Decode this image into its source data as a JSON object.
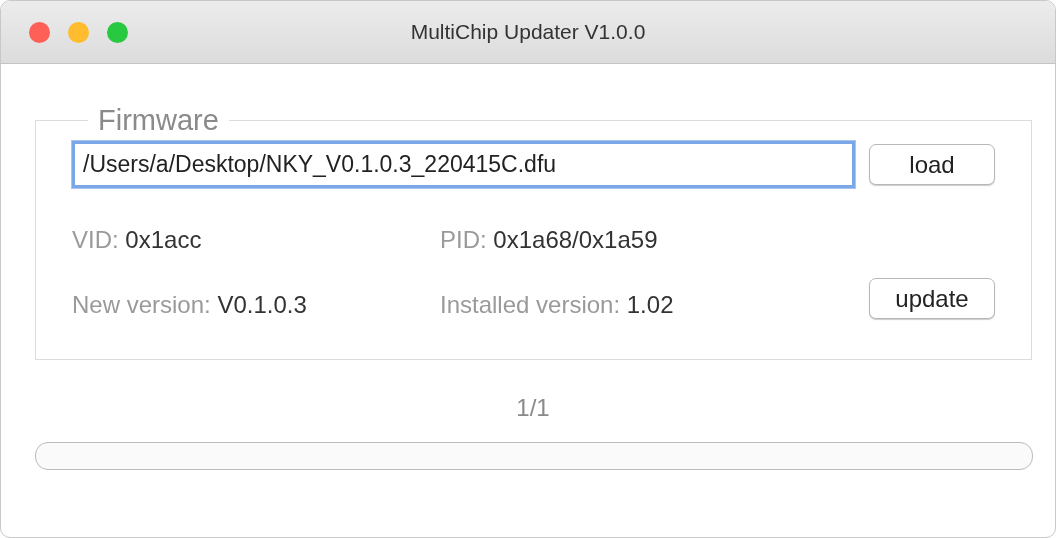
{
  "window": {
    "title": "MultiChip Updater V1.0.0"
  },
  "firmware": {
    "legend": "Firmware",
    "path": {
      "value": "/Users/a/Desktop/NKY_V0.1.0.3_220415C.dfu",
      "focused": true
    },
    "load_button": "load",
    "fields": [
      {
        "label": "VID:",
        "value": "0x1acc"
      },
      {
        "label": "PID:",
        "value": "0x1a68/0x1a59"
      },
      {
        "label": "New version:",
        "value": "V0.1.0.3"
      },
      {
        "label": "Installed version:",
        "value": "1.02"
      }
    ],
    "update_button": "update"
  },
  "progress": {
    "count": "1/1",
    "level": 0
  }
}
